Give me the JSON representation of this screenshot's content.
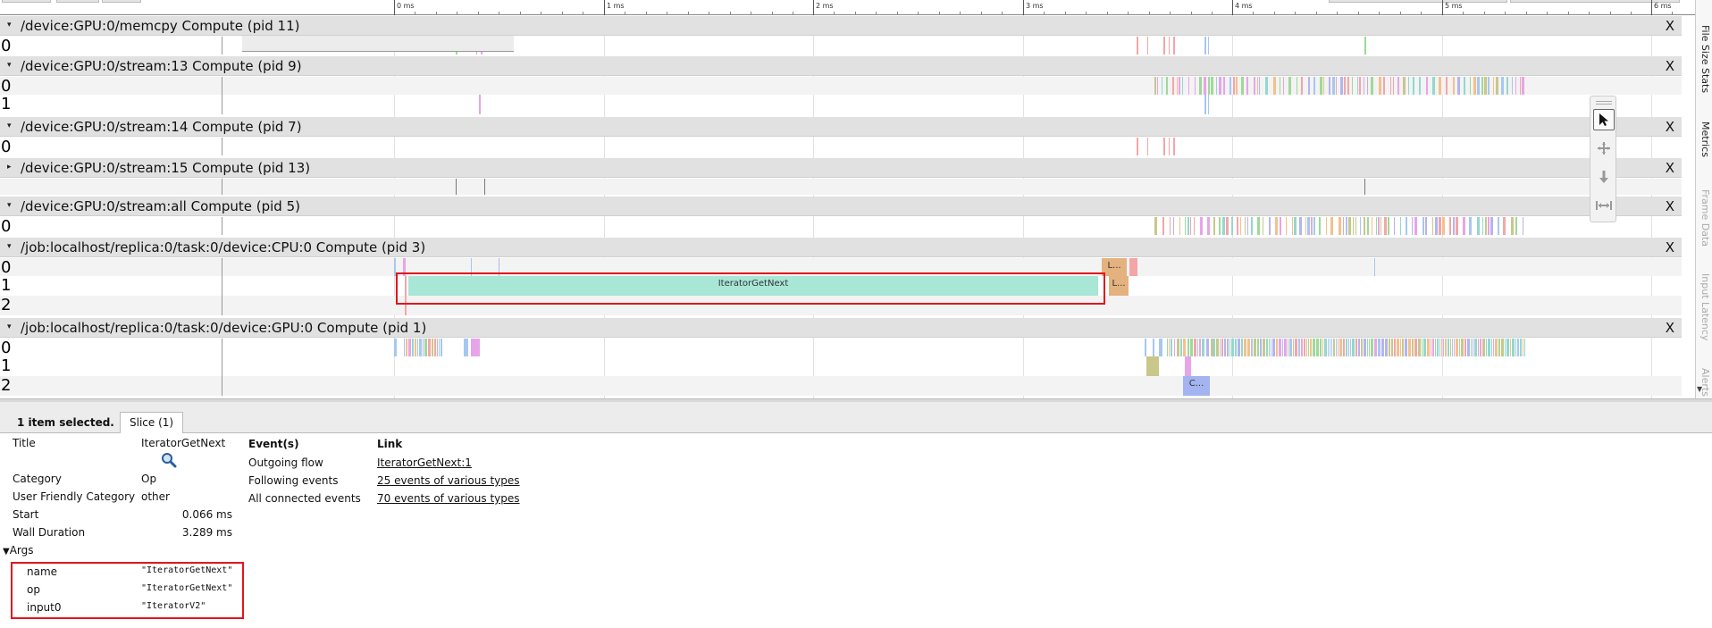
{
  "ruler": {
    "ticks": [
      "0 ms",
      "1 ms",
      "2 ms",
      "3 ms",
      "4 ms",
      "5 ms",
      "6 ms"
    ]
  },
  "processes": [
    {
      "title": "/device:GPU:0/memcpy Compute (pid 11)",
      "expanded": true,
      "rows": [
        "0"
      ]
    },
    {
      "title": "/device:GPU:0/stream:13 Compute (pid 9)",
      "expanded": true,
      "rows": [
        "0",
        "1"
      ]
    },
    {
      "title": "/device:GPU:0/stream:14 Compute (pid 7)",
      "expanded": true,
      "rows": [
        "0"
      ]
    },
    {
      "title": "/device:GPU:0/stream:15 Compute (pid 13)",
      "expanded": false,
      "rows": []
    },
    {
      "title": "/device:GPU:0/stream:all Compute (pid 5)",
      "expanded": true,
      "rows": [
        "0"
      ]
    },
    {
      "title": "/job:localhost/replica:0/task:0/device:CPU:0 Compute (pid 3)",
      "expanded": true,
      "rows": [
        "0",
        "1",
        "2"
      ]
    },
    {
      "title": "/job:localhost/replica:0/task:0/device:GPU:0 Compute (pid 1)",
      "expanded": true,
      "rows": [
        "0",
        "1",
        "2"
      ]
    }
  ],
  "close_label": "X",
  "expanded_arrow": "▾",
  "collapsed_arrow": "▸",
  "slice_labels": {
    "iterator": "IteratorGetNext",
    "cpu_l0": "L...",
    "cpu_l1": "L...",
    "gpu_c": "C..."
  },
  "side_tabs": [
    "File Size Stats",
    "Metrics",
    "Frame Data",
    "Input Latency",
    "Alerts"
  ],
  "tools": [
    "select-tool",
    "pan-tool",
    "zoom-tool",
    "timing-tool"
  ],
  "colors": {
    "selection": "#e1161c",
    "iterator_slice": "#a8e6d6",
    "header_bg": "#e1e1e1"
  },
  "analysis": {
    "selected_count": "1 item selected.",
    "tab_label": "Slice (1)",
    "props": {
      "title_label": "Title",
      "title_value": "IteratorGetNext",
      "category_label": "Category",
      "category_value": "Op",
      "ufc_label": "User Friendly Category",
      "ufc_value": "other",
      "start_label": "Start",
      "start_value": "0.066 ms",
      "wall_label": "Wall Duration",
      "wall_value": "3.289 ms",
      "args_label": "Args",
      "args": [
        {
          "key": "name",
          "value": "\"IteratorGetNext\""
        },
        {
          "key": "op",
          "value": "\"IteratorGetNext\""
        },
        {
          "key": "input0",
          "value": "\"IteratorV2\""
        }
      ]
    },
    "events": {
      "head_events": "Event(s)",
      "head_link": "Link",
      "rows": [
        {
          "event": "Outgoing flow",
          "link": "IteratorGetNext:1"
        },
        {
          "event": "Following events",
          "link": "25 events of various types"
        },
        {
          "event": "All connected events",
          "link": "70 events of various types"
        }
      ]
    }
  }
}
